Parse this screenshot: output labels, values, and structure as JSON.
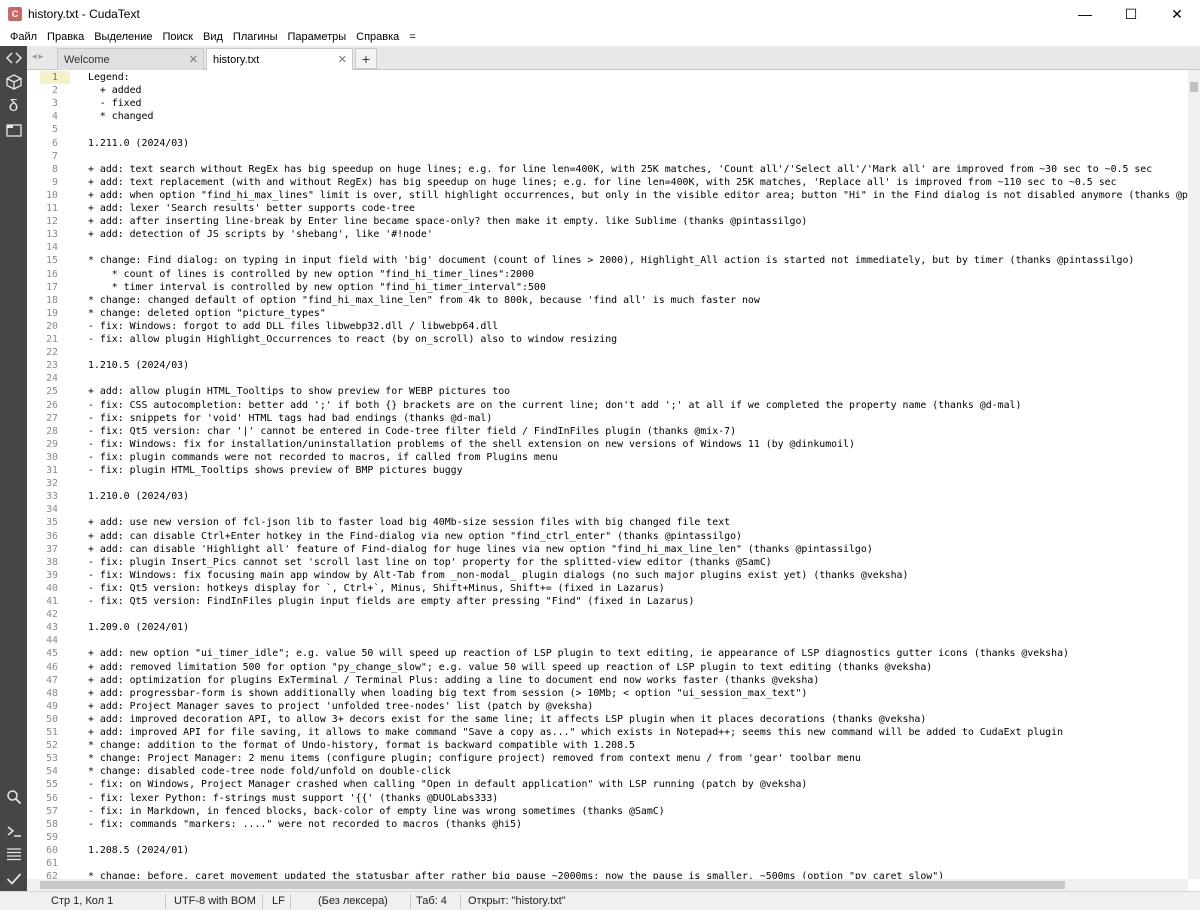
{
  "window": {
    "title": "history.txt - CudaText",
    "minimize": "—",
    "maximize": "☐",
    "close": "✕"
  },
  "menu": [
    "Файл",
    "Правка",
    "Выделение",
    "Поиск",
    "Вид",
    "Плагины",
    "Параметры",
    "Справка",
    "="
  ],
  "tabs": [
    {
      "label": "Welcome",
      "close": "✕"
    },
    {
      "label": "history.txt",
      "close": "✕"
    }
  ],
  "tab_add": "+",
  "editor": {
    "current_line": 1,
    "lines": [
      "Legend:",
      "  + added",
      "  - fixed",
      "  * changed",
      "",
      "1.211.0 (2024/03)",
      "",
      "+ add: text search without RegEx has big speedup on huge lines; e.g. for line len=400K, with 25K matches, 'Count all'/'Select all'/'Mark all' are improved from ~30 sec to ~0.5 sec",
      "+ add: text replacement (with and without RegEx) has big speedup on huge lines; e.g. for line len=400K, with 25K matches, 'Replace all' is improved from ~110 sec to ~0.5 sec",
      "+ add: when option \"find_hi_max_lines\" limit is over, still highlight occurrences, but only in the visible editor area; button \"Hi\" in the Find dialog is not disabled anymore (thanks @pintassilgo)",
      "+ add: lexer 'Search results' better supports code-tree",
      "+ add: after inserting line-break by Enter line became space-only? then make it empty. like Sublime (thanks @pintassilgo)",
      "+ add: detection of JS scripts by 'shebang', like '#!node'",
      "",
      "* change: Find dialog: on typing in input field with 'big' document (count of lines > 2000), Highlight_All action is started not immediately, but by timer (thanks @pintassilgo)",
      "    * count of lines is controlled by new option \"find_hi_timer_lines\":2000",
      "    * timer interval is controlled by new option \"find_hi_timer_interval\":500",
      "* change: changed default of option \"find_hi_max_line_len\" from 4k to 800k, because 'find all' is much faster now",
      "* change: deleted option \"picture_types\"",
      "- fix: Windows: forgot to add DLL files libwebp32.dll / libwebp64.dll",
      "- fix: allow plugin Highlight_Occurrences to react (by on_scroll) also to window resizing",
      "",
      "1.210.5 (2024/03)",
      "",
      "+ add: allow plugin HTML_Tooltips to show preview for WEBP pictures too",
      "- fix: CSS autocompletion: better add ';' if both {} brackets are on the current line; don't add ';' at all if we completed the property name (thanks @d-mal)",
      "- fix: snippets for 'void' HTML tags had bad endings (thanks @d-mal)",
      "- fix: Qt5 version: char '|' cannot be entered in Code-tree filter field / FindInFiles plugin (thanks @mix-7)",
      "- fix: Windows: fix for installation/uninstallation problems of the shell extension on new versions of Windows 11 (by @dinkumoil)",
      "- fix: plugin commands were not recorded to macros, if called from Plugins menu",
      "- fix: plugin HTML_Tooltips shows preview of BMP pictures buggy",
      "",
      "1.210.0 (2024/03)",
      "",
      "+ add: use new version of fcl-json lib to faster load big 40Mb-size session files with big changed file text",
      "+ add: can disable Ctrl+Enter hotkey in the Find-dialog via new option \"find_ctrl_enter\" (thanks @pintassilgo)",
      "+ add: can disable 'Highlight all' feature of Find-dialog for huge lines via new option \"find_hi_max_line_len\" (thanks @pintassilgo)",
      "- fix: plugin Insert_Pics cannot set 'scroll last line on top' property for the splitted-view editor (thanks @SamC)",
      "- fix: Windows: fix focusing main app window by Alt-Tab from _non-modal_ plugin dialogs (no such major plugins exist yet) (thanks @veksha)",
      "- fix: Qt5 version: hotkeys display for `, Ctrl+`, Minus, Shift+Minus, Shift+= (fixed in Lazarus)",
      "- fix: Qt5 version: FindInFiles plugin input fields are empty after pressing \"Find\" (fixed in Lazarus)",
      "",
      "1.209.0 (2024/01)",
      "",
      "+ add: new option \"ui_timer_idle\"; e.g. value 50 will speed up reaction of LSP plugin to text editing, ie appearance of LSP diagnostics gutter icons (thanks @veksha)",
      "+ add: removed limitation 500 for option \"py_change_slow\"; e.g. value 50 will speed up reaction of LSP plugin to text editing (thanks @veksha)",
      "+ add: optimization for plugins ExTerminal / Terminal Plus: adding a line to document end now works faster (thanks @veksha)",
      "+ add: progressbar-form is shown additionally when loading big text from session (> 10Mb; < option \"ui_session_max_text\")",
      "+ add: Project Manager saves to project 'unfolded tree-nodes' list (patch by @veksha)",
      "+ add: improved decoration API, to allow 3+ decors exist for the same line; it affects LSP plugin when it places decorations (thanks @veksha)",
      "+ add: improved API for file saving, it allows to make command \"Save a copy as...\" which exists in Notepad++; seems this new command will be added to CudaExt plugin",
      "* change: addition to the format of Undo-history, format is backward compatible with 1.208.5",
      "* change: Project Manager: 2 menu items (configure plugin; configure project) removed from context menu / from 'gear' toolbar menu",
      "* change: disabled code-tree node fold/unfold on double-click",
      "- fix: on Windows, Project Manager crashed when calling \"Open in default application\" with LSP running (patch by @veksha)",
      "- fix: lexer Python: f-strings must support '{{' (thanks @DUOLabs333)",
      "- fix: in Markdown, in fenced blocks, back-color of empty line was wrong sometimes (thanks @SamC)",
      "- fix: commands \"markers: ....\" were not recorded to macros (thanks @hi5)",
      "",
      "1.208.5 (2024/01)",
      "",
      "* change: before, caret movement updated the statusbar after rather big pause ~2000ms; now the pause is smaller, ~500ms (option \"py_caret_slow\")"
    ]
  },
  "statusbar": {
    "position": "Стр 1, Кол 1",
    "encoding": "UTF-8 with BOM",
    "line_ending": "LF",
    "lexer": "(Без лексера)",
    "tab": "Таб: 4",
    "message": "Открыт: \"history.txt\""
  },
  "sidebar_icons": [
    "code-tree-icon",
    "project-icon",
    "snippets-icon",
    "tabs-list-icon",
    "search-icon",
    "console-icon",
    "output-icon",
    "validate-icon"
  ],
  "colors": {
    "sidebar": "#464646",
    "current_line_gutter": "#f4f2c8"
  }
}
